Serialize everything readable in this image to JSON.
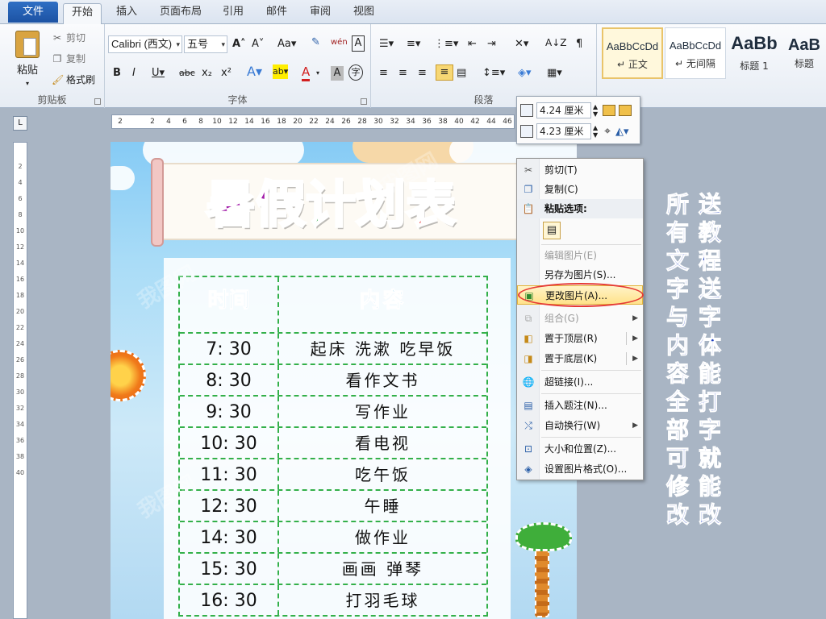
{
  "tabs": {
    "file": "文件",
    "items": [
      "开始",
      "插入",
      "页面布局",
      "引用",
      "邮件",
      "审阅",
      "视图"
    ],
    "active_index": 0
  },
  "ribbon": {
    "clipboard": {
      "paste": "粘贴",
      "cut": "剪切",
      "copy": "复制",
      "format_painter": "格式刷",
      "title": "剪贴板"
    },
    "font": {
      "font_name": "Calibri (西文)",
      "font_size": "五号",
      "title": "字体"
    },
    "paragraph": {
      "title": "段落"
    },
    "styles": [
      {
        "sample": "AaBbCcDd",
        "name": "正文",
        "selected": true
      },
      {
        "sample": "AaBbCcDd",
        "name": "无间隔",
        "selected": false
      },
      {
        "sample": "AaBb",
        "name": "标题 1",
        "selected": false
      },
      {
        "sample": "AaB",
        "name": "标题",
        "selected": false
      }
    ]
  },
  "ruler": {
    "h_ticks": [
      "2",
      "",
      "2",
      "4",
      "6",
      "8",
      "10",
      "12",
      "14",
      "16",
      "18",
      "20",
      "22",
      "24",
      "26",
      "28",
      "30",
      "32",
      "34",
      "36",
      "38",
      "40",
      "42",
      "44",
      "46"
    ],
    "v_ticks": [
      "",
      "2",
      "4",
      "6",
      "8",
      "10",
      "12",
      "14",
      "16",
      "18",
      "20",
      "22",
      "24",
      "26",
      "28",
      "30",
      "32",
      "34",
      "36",
      "38",
      "40"
    ]
  },
  "document": {
    "title_chars": [
      {
        "ch": "暑",
        "color": "#a11aa8"
      },
      {
        "ch": "假",
        "color": "#a11aa8"
      },
      {
        "ch": "计",
        "color": "#1aa12f"
      },
      {
        "ch": "划",
        "color": "#e6701a"
      },
      {
        "ch": "表",
        "color": "#e52020"
      }
    ],
    "table": {
      "header_time": "时间",
      "header_content": "内容",
      "rows": [
        {
          "time": "7: 30",
          "content": "起床 洗漱 吃早饭"
        },
        {
          "time": "8: 30",
          "content": "看作文书"
        },
        {
          "time": "9: 30",
          "content": "写作业"
        },
        {
          "time": "10: 30",
          "content": "看电视"
        },
        {
          "time": "11: 30",
          "content": "吃午饭"
        },
        {
          "time": "12: 30",
          "content": "午睡"
        },
        {
          "time": "14: 30",
          "content": "做作业"
        },
        {
          "time": "15: 30",
          "content": "画画 弹琴"
        },
        {
          "time": "16: 30",
          "content": "打羽毛球"
        }
      ]
    }
  },
  "size_toolbar": {
    "height": "4.24 厘米",
    "width": "4.23 厘米"
  },
  "context_menu": {
    "cut": "剪切(T)",
    "copy": "复制(C)",
    "paste_options": "粘贴选项:",
    "edit_picture": "编辑图片(E)",
    "save_as_picture": "另存为图片(S)...",
    "change_picture": "更改图片(A)...",
    "group": "组合(G)",
    "bring_to_front": "置于顶层(R)",
    "send_to_back": "置于底层(K)",
    "hyperlink": "超链接(I)...",
    "insert_caption": "插入题注(N)...",
    "wrap_text": "自动换行(W)",
    "size_position": "大小和位置(Z)...",
    "format_picture": "设置图片格式(O)..."
  },
  "promo": {
    "line1": "送教程 送字体 能打字就能改",
    "line2": "所有文字与内容全部可修改"
  },
  "colors": {
    "accent": "#1c52a3",
    "promo_text": "#1f3fbf",
    "table_border": "#34b04a",
    "header_text": "#2aa1d9",
    "highlight_oval": "#e53935"
  }
}
